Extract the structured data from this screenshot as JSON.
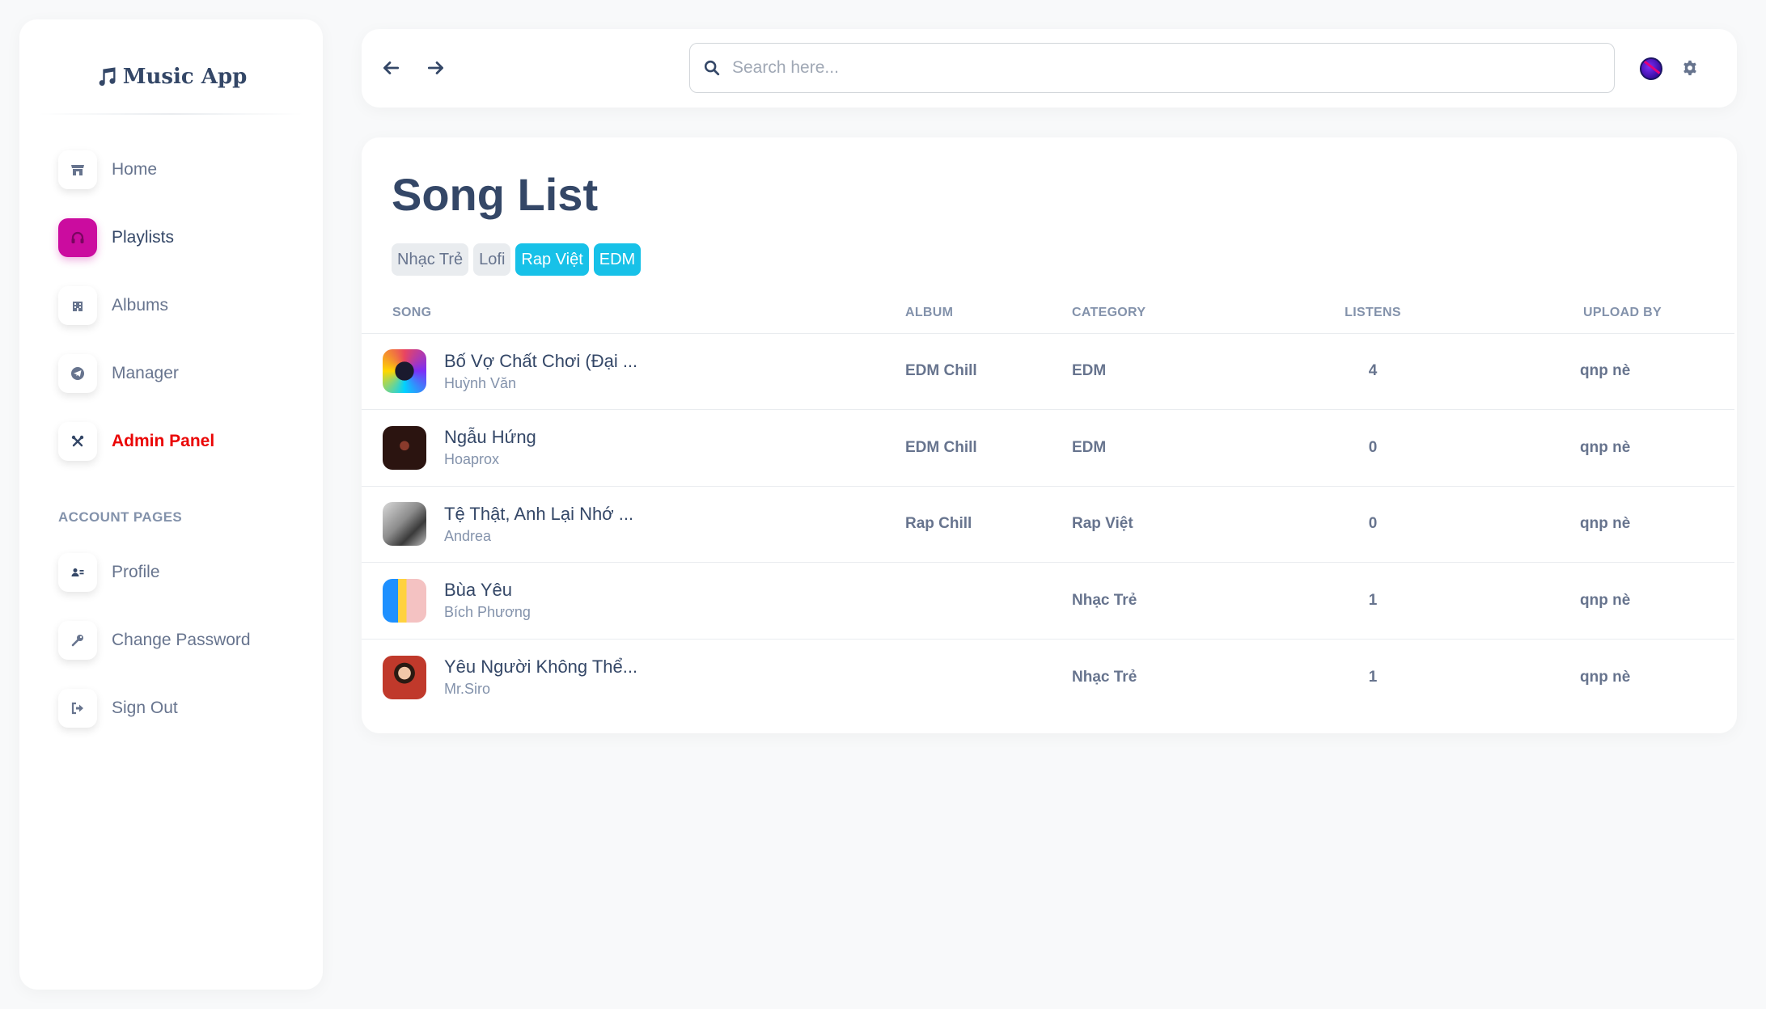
{
  "brand": {
    "name": "Music App"
  },
  "sidebar": {
    "items": [
      {
        "label": "Home",
        "icon": "store-icon"
      },
      {
        "label": "Playlists",
        "icon": "headphones-icon",
        "active": true
      },
      {
        "label": "Albums",
        "icon": "building-icon"
      },
      {
        "label": "Manager",
        "icon": "telegram-icon"
      },
      {
        "label": "Admin Panel",
        "icon": "tools-icon"
      }
    ],
    "section_title": "ACCOUNT PAGES",
    "account_items": [
      {
        "label": "Profile",
        "icon": "user-card-icon"
      },
      {
        "label": "Change Password",
        "icon": "key-icon"
      },
      {
        "label": "Sign Out",
        "icon": "sign-out-icon"
      }
    ]
  },
  "topbar": {
    "search_placeholder": "Search here..."
  },
  "main": {
    "title": "Song List",
    "tags": [
      "Nhạc Trẻ",
      "Lofi",
      "Rap Việt",
      "EDM"
    ],
    "columns": [
      "SONG",
      "ALBUM",
      "CATEGORY",
      "LISTENS",
      "UPLOAD BY"
    ],
    "rows": [
      {
        "name": "Bố Vợ Chất Chơi (Đại ...",
        "artist": "Huỳnh Văn",
        "album": "EDM Chill",
        "category": "EDM",
        "listens": "4",
        "uploader": "qnp nè"
      },
      {
        "name": "Ngẫu Hứng",
        "artist": "Hoaprox",
        "album": "EDM Chill",
        "category": "EDM",
        "listens": "0",
        "uploader": "qnp nè"
      },
      {
        "name": "Tệ Thật, Anh Lại Nhớ ...",
        "artist": "Andrea",
        "album": "Rap Chill",
        "category": "Rap Việt",
        "listens": "0",
        "uploader": "qnp nè"
      },
      {
        "name": "Bùa Yêu",
        "artist": "Bích Phương",
        "album": "",
        "category": "Nhạc Trẻ",
        "listens": "1",
        "uploader": "qnp nè"
      },
      {
        "name": "Yêu Người Không Thể...",
        "artist": "Mr.Siro",
        "album": "",
        "category": "Nhạc Trẻ",
        "listens": "1",
        "uploader": "qnp nè"
      }
    ]
  },
  "colors": {
    "accent": "#cb0c9f",
    "tag_active": "#17c1e8",
    "danger": "#ea0606",
    "text_dark": "#344767",
    "text_muted": "#67748e"
  }
}
